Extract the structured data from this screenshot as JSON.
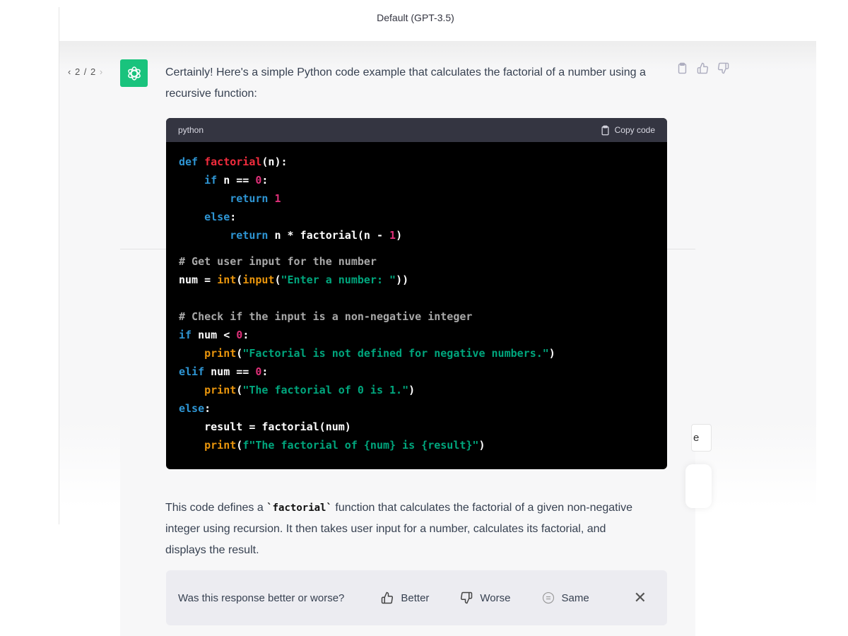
{
  "header": {
    "title": "Default (GPT-3.5)"
  },
  "pager": {
    "prev": "‹",
    "label": "2 / 2",
    "next": "›"
  },
  "message": {
    "intro": "Certainly! Here's a simple Python code example that calculates the factorial of a number using a recursive function:",
    "explanation_before": "This code defines a ",
    "explanation_code": "`factorial`",
    "explanation_after": " function that calculates the factorial of a given non-negative integer using recursion. It then takes user input for a number, calculates its factorial, and displays the result."
  },
  "code": {
    "language": "python",
    "copy_label": "Copy code",
    "lines": [
      [
        [
          "def ",
          "kw"
        ],
        [
          "factorial",
          "fn"
        ],
        [
          "(n):",
          ""
        ]
      ],
      [
        [
          "    ",
          ""
        ],
        [
          "if ",
          "kw"
        ],
        [
          "n == ",
          ""
        ],
        [
          "0",
          "num"
        ],
        [
          ":",
          ""
        ]
      ],
      [
        [
          "        ",
          ""
        ],
        [
          "return ",
          "kw"
        ],
        [
          "1",
          "num"
        ]
      ],
      [
        [
          "    ",
          ""
        ],
        [
          "else",
          "kw"
        ],
        [
          ":",
          ""
        ]
      ],
      [
        [
          "        ",
          ""
        ],
        [
          "return ",
          "kw"
        ],
        [
          "n * factorial(n - ",
          ""
        ],
        [
          "1",
          "num"
        ],
        [
          ")",
          ""
        ]
      ],
      [
        [
          "# Get user input for the number",
          "cm"
        ]
      ],
      [
        [
          "num = ",
          ""
        ],
        [
          "int",
          "bi"
        ],
        [
          "(",
          ""
        ],
        [
          "input",
          "bi"
        ],
        [
          "(",
          ""
        ],
        [
          "\"Enter a number: \"",
          "str"
        ],
        [
          "))",
          ""
        ]
      ],
      [
        [
          "",
          ""
        ]
      ],
      [
        [
          "# Check if the input is a non-negative integer",
          "cm"
        ]
      ],
      [
        [
          "if ",
          "kw"
        ],
        [
          "num < ",
          ""
        ],
        [
          "0",
          "num"
        ],
        [
          ":",
          ""
        ]
      ],
      [
        [
          "    ",
          ""
        ],
        [
          "print",
          "bi"
        ],
        [
          "(",
          ""
        ],
        [
          "\"Factorial is not defined for negative numbers.\"",
          "str"
        ],
        [
          ")",
          ""
        ]
      ],
      [
        [
          "elif ",
          "kw"
        ],
        [
          "num == ",
          ""
        ],
        [
          "0",
          "num"
        ],
        [
          ":",
          ""
        ]
      ],
      [
        [
          "    ",
          ""
        ],
        [
          "print",
          "bi"
        ],
        [
          "(",
          ""
        ],
        [
          "\"The factorial of 0 is 1.\"",
          "str"
        ],
        [
          ")",
          ""
        ]
      ],
      [
        [
          "else",
          "kw"
        ],
        [
          ":",
          ""
        ]
      ],
      [
        [
          "    ",
          ""
        ],
        [
          "result = factorial(num)",
          ""
        ]
      ],
      [
        [
          "    ",
          ""
        ],
        [
          "print",
          "bi"
        ],
        [
          "(",
          ""
        ],
        [
          "f\"The factorial of {num} is {result}\"",
          "str"
        ],
        [
          ")",
          ""
        ]
      ]
    ]
  },
  "feedback": {
    "question": "Was this response better or worse?",
    "better": "Better",
    "worse": "Worse",
    "same": "Same"
  },
  "stray": {
    "button_text": "e"
  },
  "colors": {
    "avatar": "#19c37d",
    "code_bg": "#000000",
    "code_header": "#343541"
  }
}
